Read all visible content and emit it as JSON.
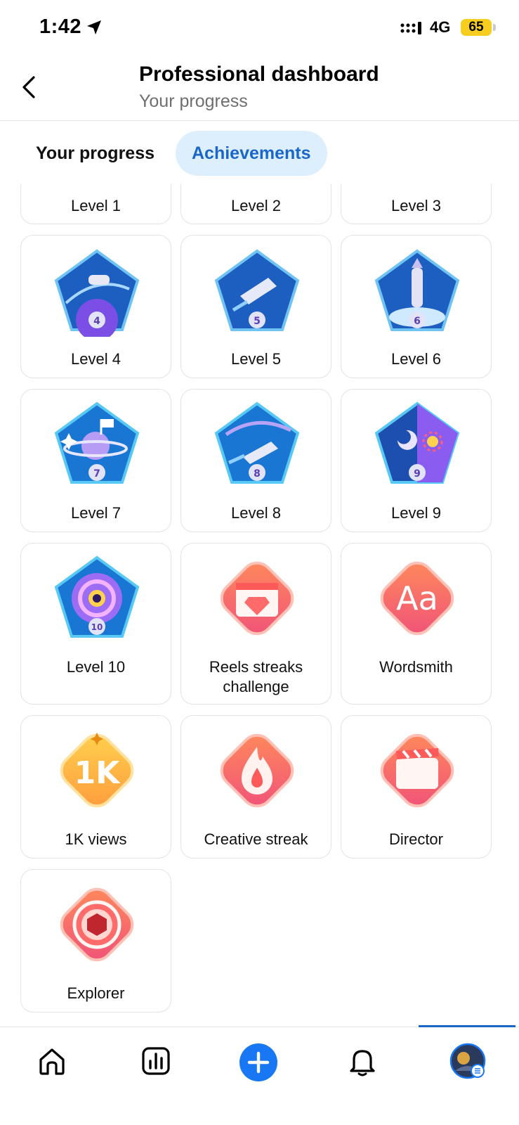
{
  "status_bar": {
    "time": "1:42",
    "network": "4G",
    "battery": "65",
    "icons": [
      "location-arrow-icon",
      "signal-bars-icon",
      "battery-icon"
    ]
  },
  "header": {
    "title": "Professional dashboard",
    "subtitle": "Your progress",
    "back_icon": "chevron-left-icon"
  },
  "tabs": [
    {
      "label": "Your progress",
      "selected": false
    },
    {
      "label": "Achievements",
      "selected": true
    }
  ],
  "achievements": [
    {
      "label": "Level 1",
      "badge": "level-badge"
    },
    {
      "label": "Level 2",
      "badge": "level-badge"
    },
    {
      "label": "Level 3",
      "badge": "level-badge"
    },
    {
      "label": "Level 4",
      "badge": "level-badge",
      "number": "4"
    },
    {
      "label": "Level 5",
      "badge": "level-badge",
      "number": "5"
    },
    {
      "label": "Level 6",
      "badge": "level-badge",
      "number": "6"
    },
    {
      "label": "Level 7",
      "badge": "level-badge",
      "number": "7"
    },
    {
      "label": "Level 8",
      "badge": "level-badge",
      "number": "8"
    },
    {
      "label": "Level 9",
      "badge": "level-badge",
      "number": "9"
    },
    {
      "label": "Level 10",
      "badge": "level-badge",
      "number": "10"
    },
    {
      "label": "Reels streaks challenge",
      "badge": "reels-streak-badge"
    },
    {
      "label": "Wordsmith",
      "badge": "wordsmith-badge",
      "glyph": "Aa"
    },
    {
      "label": "1K views",
      "badge": "views-badge",
      "glyph": "1K"
    },
    {
      "label": "Creative streak",
      "badge": "flame-badge"
    },
    {
      "label": "Director",
      "badge": "clapperboard-badge"
    },
    {
      "label": "Explorer",
      "badge": "explorer-badge"
    }
  ],
  "bottom_nav": [
    {
      "name": "home",
      "icon": "home-icon"
    },
    {
      "name": "insights",
      "icon": "insights-icon"
    },
    {
      "name": "create",
      "icon": "plus-icon"
    },
    {
      "name": "notifications",
      "icon": "bell-icon"
    },
    {
      "name": "profile",
      "icon": "avatar",
      "selected": true
    }
  ],
  "colors": {
    "accent": "#1b67c9",
    "tab_selected_bg": "#ddeefc",
    "badge_level_blue": "#1565c0",
    "badge_coral": "#f36b6b"
  }
}
